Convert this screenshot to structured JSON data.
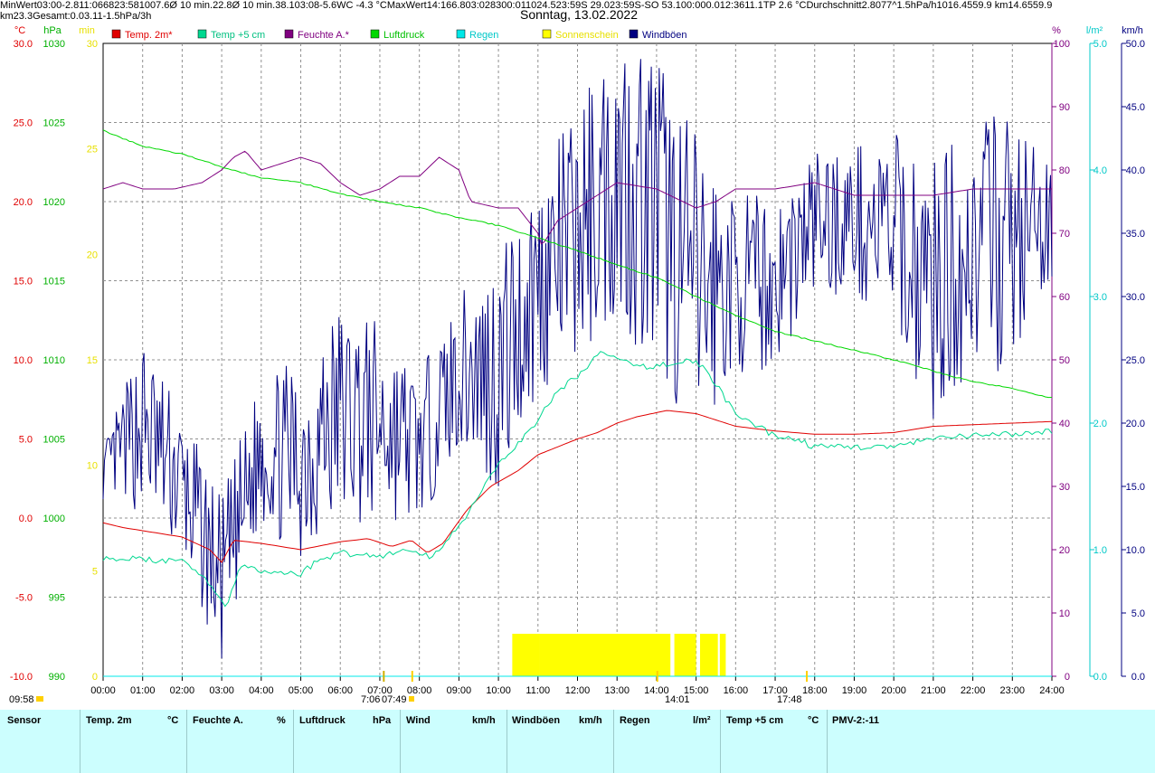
{
  "title": "Sonntag, 13.02.2022",
  "legend": [
    {
      "label": "Temp. 2m*",
      "color": "#e00000",
      "text_color": "#e00000"
    },
    {
      "label": "Temp +5 cm",
      "color": "#00d890",
      "text_color": "#00c080"
    },
    {
      "label": "Feuchte A.*",
      "color": "#800080",
      "text_color": "#800080"
    },
    {
      "label": "Luftdruck",
      "color": "#00d800",
      "text_color": "#00c000"
    },
    {
      "label": "Regen",
      "color": "#00e8e8",
      "text_color": "#00c8c8"
    },
    {
      "label": "Sonnenschein",
      "color": "#ffff00",
      "text_color": "#e8e000"
    },
    {
      "label": "Windböen",
      "color": "#000080",
      "text_color": "#000080"
    }
  ],
  "axes": {
    "temp_unit": "°C",
    "press_unit": "hPa",
    "min_unit": "min",
    "hum_unit": "%",
    "rain_unit": "l/m²",
    "wind_unit": "km/h",
    "temp_ticks": [
      "30.0",
      "25.0",
      "20.0",
      "15.0",
      "10.0",
      "5.0",
      "0.0",
      "-5.0",
      "-10.0"
    ],
    "press_ticks": [
      "1030",
      "1025",
      "1020",
      "1015",
      "1010",
      "1005",
      "1000",
      "995",
      "990"
    ],
    "min_ticks": [
      "30",
      "25",
      "20",
      "15",
      "10",
      "5",
      "0"
    ],
    "hum_ticks": [
      "100",
      "90",
      "80",
      "70",
      "60",
      "50",
      "40",
      "30",
      "20",
      "10",
      "0"
    ],
    "rain_ticks": [
      "5.0",
      "4.0",
      "3.0",
      "2.0",
      "1.0",
      "0.0"
    ],
    "wind_ticks": [
      "50.0",
      "45.0",
      "40.0",
      "35.0",
      "30.0",
      "25.0",
      "20.0",
      "15.0",
      "10.0",
      "5.0",
      "0.0"
    ],
    "x_ticks": [
      "00:00",
      "01:00",
      "02:00",
      "03:00",
      "04:00",
      "05:00",
      "06:00",
      "07:00",
      "08:00",
      "09:00",
      "10:00",
      "11:00",
      "12:00",
      "13:00",
      "14:00",
      "15:00",
      "16:00",
      "17:00",
      "18:00",
      "19:00",
      "20:00",
      "21:00",
      "22:00",
      "23:00",
      "24:00"
    ]
  },
  "markers": {
    "moon_set": "09:58",
    "sunrise": "7:06",
    "sunrise_label": "07:49",
    "noon": "14:01",
    "sunset": "17:48"
  },
  "chart_data": {
    "type": "line",
    "title": "Sonntag, 13.02.2022",
    "x_range_hours": [
      0,
      24
    ],
    "series": [
      {
        "name": "Temp. 2m*",
        "axis": "°C",
        "ylim": [
          -10,
          30
        ],
        "points": [
          [
            0,
            -0.3
          ],
          [
            0.5,
            -0.6
          ],
          [
            1,
            -0.8
          ],
          [
            2,
            -1.2
          ],
          [
            2.7,
            -2.0
          ],
          [
            3,
            -2.8
          ],
          [
            3.3,
            -1.4
          ],
          [
            4,
            -1.6
          ],
          [
            5,
            -2.0
          ],
          [
            6,
            -1.5
          ],
          [
            6.7,
            -1.3
          ],
          [
            7.3,
            -1.8
          ],
          [
            7.8,
            -1.4
          ],
          [
            8.2,
            -2.2
          ],
          [
            8.6,
            -1.6
          ],
          [
            9.2,
            0.5
          ],
          [
            9.8,
            2.0
          ],
          [
            10.5,
            3.0
          ],
          [
            11,
            4.0
          ],
          [
            12,
            5.0
          ],
          [
            12.5,
            5.4
          ],
          [
            13,
            6.0
          ],
          [
            13.5,
            6.4
          ],
          [
            14.26,
            6.8
          ],
          [
            15,
            6.6
          ],
          [
            16,
            5.8
          ],
          [
            17,
            5.5
          ],
          [
            18,
            5.3
          ],
          [
            19,
            5.3
          ],
          [
            20,
            5.4
          ],
          [
            21,
            5.8
          ],
          [
            22,
            5.9
          ],
          [
            23,
            6.0
          ],
          [
            24,
            6.1
          ]
        ]
      },
      {
        "name": "Temp +5 cm",
        "axis": "°C",
        "ylim": [
          -10,
          30
        ],
        "points": [
          [
            0,
            -2.5
          ],
          [
            1,
            -2.6
          ],
          [
            2,
            -2.8
          ],
          [
            2.5,
            -3.5
          ],
          [
            3.1,
            -5.6
          ],
          [
            3.5,
            -3.0
          ],
          [
            4,
            -3.4
          ],
          [
            5,
            -3.5
          ],
          [
            5.5,
            -2.6
          ],
          [
            6,
            -2.2
          ],
          [
            7,
            -2.4
          ],
          [
            7.7,
            -2.0
          ],
          [
            8.3,
            -2.5
          ],
          [
            9,
            -0.5
          ],
          [
            9.6,
            1.8
          ],
          [
            10.2,
            4.0
          ],
          [
            10.8,
            5.5
          ],
          [
            11.5,
            8.0
          ],
          [
            12,
            9.0
          ],
          [
            12.6,
            10.5
          ],
          [
            13.5,
            9.5
          ],
          [
            14.5,
            9.8
          ],
          [
            15,
            10.0
          ],
          [
            15.5,
            8.5
          ],
          [
            16,
            6.5
          ],
          [
            17,
            5.2
          ],
          [
            17.5,
            5.0
          ],
          [
            18,
            4.5
          ],
          [
            19,
            4.5
          ],
          [
            20,
            4.5
          ],
          [
            21,
            5.0
          ],
          [
            22,
            5.2
          ],
          [
            23,
            5.3
          ],
          [
            24,
            5.5
          ]
        ]
      },
      {
        "name": "Feuchte A.*",
        "axis": "%",
        "ylim": [
          0,
          100
        ],
        "points": [
          [
            0,
            77
          ],
          [
            0.5,
            78
          ],
          [
            1,
            77
          ],
          [
            1.8,
            77
          ],
          [
            2.5,
            78
          ],
          [
            3,
            80
          ],
          [
            3.3,
            82
          ],
          [
            3.6,
            83
          ],
          [
            4,
            80
          ],
          [
            5,
            82
          ],
          [
            5.5,
            81
          ],
          [
            6,
            78
          ],
          [
            6.5,
            76
          ],
          [
            7,
            77
          ],
          [
            7.5,
            79
          ],
          [
            8,
            79
          ],
          [
            8.5,
            82
          ],
          [
            9,
            80
          ],
          [
            9.3,
            75
          ],
          [
            10,
            74
          ],
          [
            10.5,
            74
          ],
          [
            11,
            70
          ],
          [
            11.1,
            68
          ],
          [
            11.5,
            72
          ],
          [
            12,
            74
          ],
          [
            13,
            78
          ],
          [
            14,
            77
          ],
          [
            15,
            74
          ],
          [
            15.5,
            75
          ],
          [
            16,
            77
          ],
          [
            17,
            77
          ],
          [
            18,
            78
          ],
          [
            19,
            76
          ],
          [
            20,
            76
          ],
          [
            21,
            76
          ],
          [
            22,
            77
          ],
          [
            23,
            77
          ],
          [
            24,
            77
          ]
        ]
      },
      {
        "name": "Luftdruck",
        "axis": "hPa",
        "ylim": [
          990,
          1030
        ],
        "points": [
          [
            0,
            1024.5
          ],
          [
            1,
            1023.5
          ],
          [
            2,
            1023.0
          ],
          [
            3,
            1022.2
          ],
          [
            4,
            1021.5
          ],
          [
            5,
            1021.2
          ],
          [
            6,
            1020.5
          ],
          [
            7,
            1020.0
          ],
          [
            8,
            1019.6
          ],
          [
            9,
            1019.0
          ],
          [
            10,
            1018.5
          ],
          [
            11,
            1017.7
          ],
          [
            12,
            1016.9
          ],
          [
            13,
            1016.0
          ],
          [
            14,
            1015.2
          ],
          [
            15,
            1014.0
          ],
          [
            16,
            1012.8
          ],
          [
            17,
            1011.8
          ],
          [
            18,
            1011.2
          ],
          [
            19,
            1010.6
          ],
          [
            20,
            1010.0
          ],
          [
            21,
            1009.3
          ],
          [
            22,
            1008.6
          ],
          [
            23,
            1008.2
          ],
          [
            23.97,
            1007.6
          ]
        ]
      },
      {
        "name": "Regen",
        "axis": "l/m²",
        "ylim": [
          0,
          5
        ],
        "points": [
          [
            0,
            0
          ],
          [
            24,
            0
          ]
        ]
      },
      {
        "name": "Sonnenschein",
        "axis": "min",
        "ylim": [
          0,
          30
        ],
        "intervals": [
          [
            10.35,
            11.05
          ],
          [
            11.05,
            14.35
          ],
          [
            14.45,
            15.0
          ],
          [
            15.1,
            15.55
          ],
          [
            15.6,
            15.75
          ]
        ],
        "value": 2
      }
    ],
    "wind_gusts": {
      "name": "Windböen",
      "axis": "km/h",
      "ylim": [
        0,
        50
      ],
      "envelope": [
        [
          0,
          14,
          18
        ],
        [
          1,
          13,
          27
        ],
        [
          2,
          9,
          21
        ],
        [
          3,
          1,
          14
        ],
        [
          4,
          12,
          24
        ],
        [
          5,
          9,
          25
        ],
        [
          6,
          12,
          30
        ],
        [
          7,
          12,
          28
        ],
        [
          8,
          12,
          24
        ],
        [
          9,
          18,
          30
        ],
        [
          10,
          14,
          34
        ],
        [
          11,
          22,
          40
        ],
        [
          12,
          25,
          45
        ],
        [
          13,
          28,
          52
        ],
        [
          14,
          24,
          50
        ],
        [
          15,
          18,
          43
        ],
        [
          16,
          24,
          38
        ],
        [
          17,
          24,
          38
        ],
        [
          18,
          30,
          42
        ],
        [
          19,
          30,
          42
        ],
        [
          20,
          27,
          43
        ],
        [
          21,
          20,
          41
        ],
        [
          22,
          24,
          44
        ],
        [
          23,
          24,
          45
        ],
        [
          24,
          30,
          40
        ]
      ]
    }
  },
  "table": {
    "headers": {
      "sensor": "Sensor",
      "temp": "Temp. 2m",
      "temp_u": "°C",
      "hum": "Feuchte A.",
      "hum_u": "%",
      "press": "Luftdruck",
      "press_u": "hPa",
      "wind": "Wind",
      "wind_u": "km/h",
      "gust": "Windböen",
      "gust_u": "km/h",
      "rain": "Regen",
      "rain_u": "l/m²",
      "t5": "Temp +5 cm",
      "t5_u": "°C",
      "pmv": "PMV-2:-11"
    },
    "rows": [
      {
        "label": "MinWert",
        "temp_t": "03:00",
        "temp_v": "-2.8",
        "hum_t": "11:06",
        "hum_v": "68",
        "press_t": "23:58",
        "press_v": "1007.6",
        "wind_t": "Ø 10 min.",
        "wind_v": "22.8",
        "gust_t": "Ø 10 min.",
        "gust_v": "38.1",
        "rain_t": "",
        "rain_v": "",
        "t5_t": "03:08",
        "t5_v": "-5.6",
        "pmv": "WC -4.3 °C"
      },
      {
        "label": "MaxWert",
        "temp_t": "14:16",
        "temp_v": "6.8",
        "hum_t": "03:02",
        "hum_v": "83",
        "press_t": "00:01",
        "press_v": "1024.5",
        "wind_t": "23:59",
        "wind_v": "S 29.0",
        "gust_t": "23:59",
        "gust_v": "S-SO 53.1",
        "rain_t": "00:00",
        "rain_v": "0.0",
        "t5_t": "12:36",
        "t5_v": "11.1",
        "pmv": "TP 2.6 °C"
      },
      {
        "label": "Durchschnitt",
        "temp_t": "",
        "temp_v": "2.80",
        "hum_t": "",
        "hum_v": "77",
        "press_t": "^1.5hPa/h",
        "press_v": "1016.4",
        "wind_t": "559.9 km",
        "wind_v": "14.6",
        "gust_t": "559.9 km",
        "gust_v": "23.3",
        "rain_t": "Gesamt:",
        "rain_v": "0.0",
        "t5_t": "",
        "t5_v": "3.11",
        "pmv": "-1.5hPa/3h"
      }
    ]
  }
}
